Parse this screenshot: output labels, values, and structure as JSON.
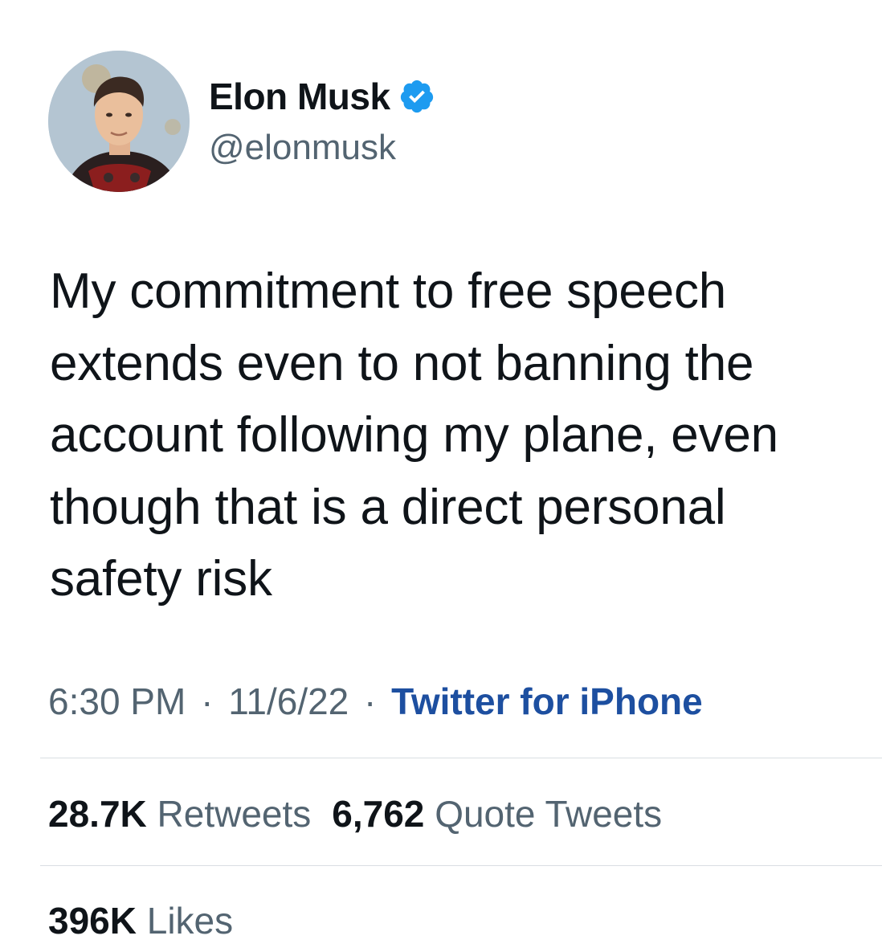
{
  "author": {
    "display_name": "Elon Musk",
    "handle": "@elonmusk",
    "verified_icon": "verified-badge-icon",
    "avatar_icon": "profile-photo-avatar"
  },
  "tweet": {
    "text_lines": [
      "My commitment to free speech",
      "extends even to not banning the",
      "account following my plane, even",
      "though that is a direct personal",
      "safety risk"
    ]
  },
  "meta": {
    "time": "6:30 PM",
    "separator": "·",
    "date": "11/6/22",
    "source": "Twitter for iPhone"
  },
  "stats": {
    "retweets_count": "28.7K",
    "retweets_label": "Retweets",
    "quotes_count": "6,762",
    "quotes_label": "Quote Tweets",
    "likes_count": "396K",
    "likes_label": "Likes"
  },
  "colors": {
    "text_primary": "#0f1419",
    "text_secondary": "#536471",
    "source_link": "#1d4fa0",
    "verified": "#1d9bf0",
    "divider": "#d9dee2"
  }
}
